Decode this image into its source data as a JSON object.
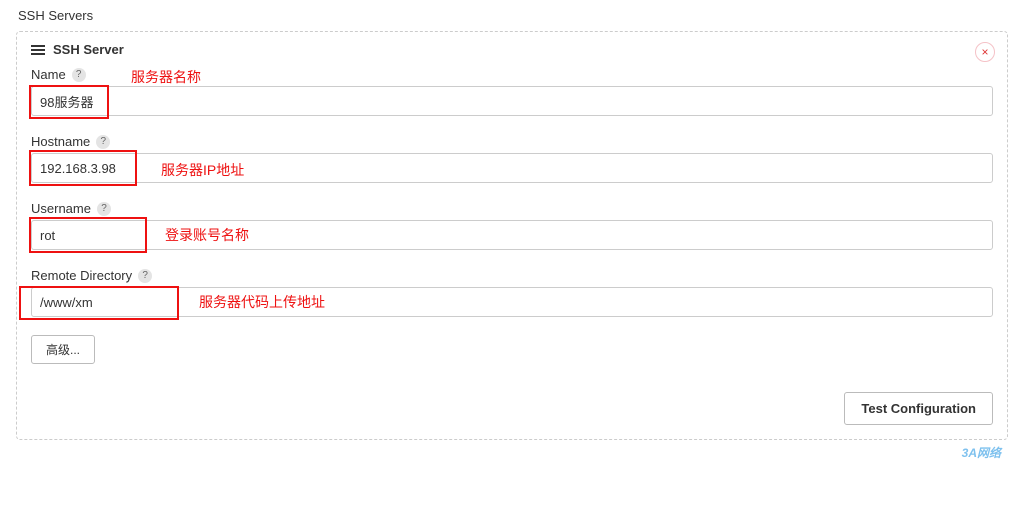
{
  "section_title": "SSH Servers",
  "panel": {
    "title": "SSH Server",
    "close_label": "×"
  },
  "fields": {
    "name": {
      "label": "Name",
      "value": "98服务器",
      "annotation": "服务器名称"
    },
    "hostname": {
      "label": "Hostname",
      "value": "192.168.3.98",
      "annotation": "服务器IP地址"
    },
    "username": {
      "label": "Username",
      "value": "rot",
      "annotation": "登录账号名称"
    },
    "remote_dir": {
      "label": "Remote Directory",
      "value": "/www/xm",
      "annotation": "服务器代码上传地址"
    }
  },
  "buttons": {
    "advanced": "高级...",
    "test_config": "Test Configuration"
  },
  "help_glyph": "?",
  "watermark": "3A网络"
}
